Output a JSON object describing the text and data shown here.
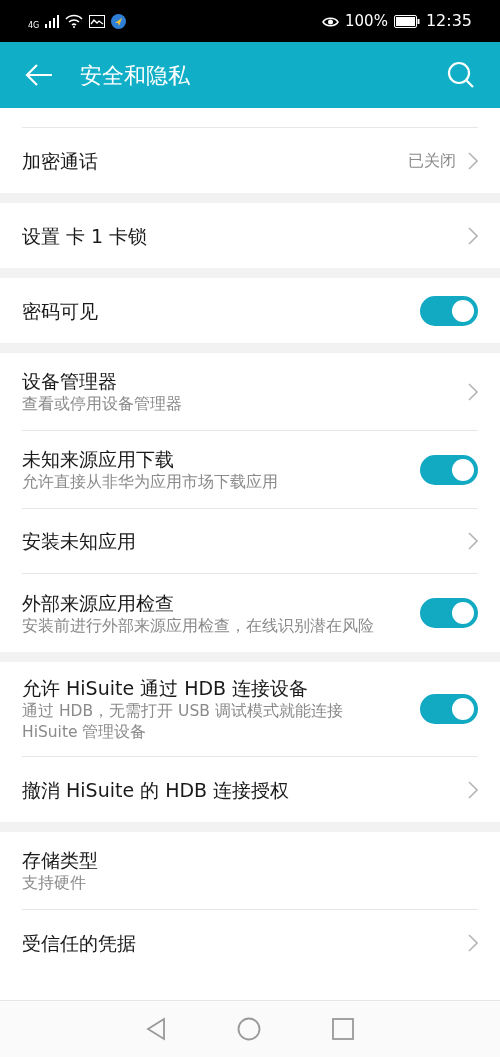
{
  "status_bar": {
    "network": "4G",
    "battery": "100%",
    "time": "12:35"
  },
  "app_bar": {
    "title": "安全和隐私"
  },
  "groups": [
    {
      "items": [
        {
          "kind": "chevron",
          "title": "加密通话",
          "value": "已关闭"
        }
      ]
    },
    {
      "items": [
        {
          "kind": "chevron",
          "title": "设置 卡 1 卡锁"
        }
      ]
    },
    {
      "items": [
        {
          "kind": "toggle",
          "title": "密码可见",
          "on": true
        }
      ]
    },
    {
      "items": [
        {
          "kind": "chevron",
          "title": "设备管理器",
          "subtitle": "查看或停用设备管理器"
        },
        {
          "kind": "toggle",
          "title": "未知来源应用下载",
          "subtitle": "允许直接从非华为应用市场下载应用",
          "on": true
        },
        {
          "kind": "chevron",
          "title": "安装未知应用"
        },
        {
          "kind": "toggle",
          "title": "外部来源应用检查",
          "subtitle": "安装前进行外部来源应用检查，在线识别潜在风险",
          "on": true
        }
      ]
    },
    {
      "items": [
        {
          "kind": "toggle",
          "title": "允许 HiSuite 通过 HDB 连接设备",
          "subtitle": "通过 HDB，无需打开 USB 调试模式就能连接 HiSuite 管理设备",
          "on": true
        },
        {
          "kind": "chevron",
          "title": "撤消 HiSuite 的 HDB 连接授权"
        }
      ]
    },
    {
      "items": [
        {
          "kind": "plain",
          "title": "存储类型",
          "subtitle": "支持硬件"
        },
        {
          "kind": "chevron",
          "title": "受信任的凭据"
        }
      ]
    }
  ]
}
